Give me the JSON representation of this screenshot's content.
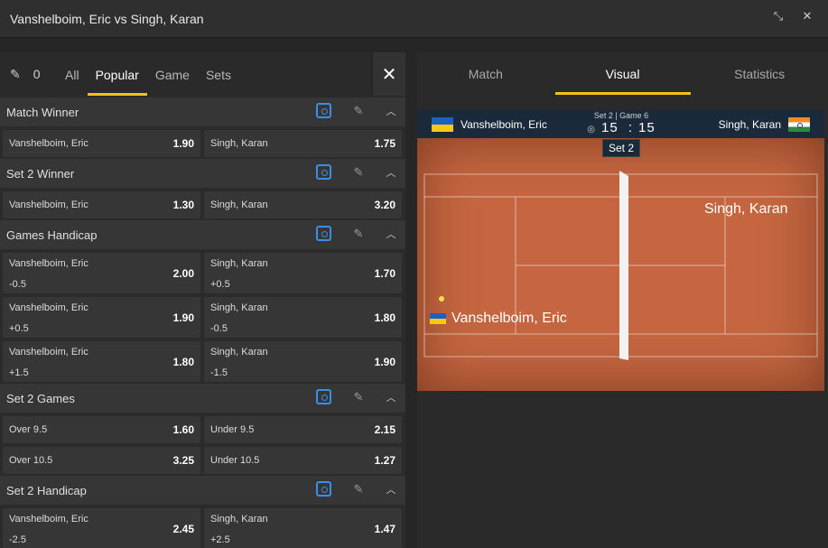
{
  "window": {
    "title": "Vanshelboim, Eric vs Singh, Karan"
  },
  "left_tabs": {
    "pin_count": "0",
    "tabs": [
      "All",
      "Popular",
      "Game",
      "Sets"
    ],
    "active": "Popular"
  },
  "markets": [
    {
      "name": "Match Winner",
      "rows": [
        [
          {
            "name": "Vanshelboim, Eric",
            "price": "1.90"
          },
          {
            "name": "Singh, Karan",
            "price": "1.75"
          }
        ]
      ]
    },
    {
      "name": "Set 2 Winner",
      "rows": [
        [
          {
            "name": "Vanshelboim, Eric",
            "price": "1.30"
          },
          {
            "name": "Singh, Karan",
            "price": "3.20"
          }
        ]
      ]
    },
    {
      "name": "Games Handicap",
      "rows": [
        [
          {
            "name": "Vanshelboim, Eric",
            "line": "-0.5",
            "price": "2.00"
          },
          {
            "name": "Singh, Karan",
            "line": "+0.5",
            "price": "1.70"
          }
        ],
        [
          {
            "name": "Vanshelboim, Eric",
            "line": "+0.5",
            "price": "1.90"
          },
          {
            "name": "Singh, Karan",
            "line": "-0.5",
            "price": "1.80"
          }
        ],
        [
          {
            "name": "Vanshelboim, Eric",
            "line": "+1.5",
            "price": "1.80"
          },
          {
            "name": "Singh, Karan",
            "line": "-1.5",
            "price": "1.90"
          }
        ]
      ]
    },
    {
      "name": "Set 2 Games",
      "rows": [
        [
          {
            "name": "Over 9.5",
            "price": "1.60"
          },
          {
            "name": "Under 9.5",
            "price": "2.15"
          }
        ],
        [
          {
            "name": "Over 10.5",
            "price": "3.25"
          },
          {
            "name": "Under 10.5",
            "price": "1.27"
          }
        ]
      ]
    },
    {
      "name": "Set 2 Handicap",
      "rows": [
        [
          {
            "name": "Vanshelboim, Eric",
            "line": "-2.5",
            "price": "2.45"
          },
          {
            "name": "Singh, Karan",
            "line": "+2.5",
            "price": "1.47"
          }
        ]
      ]
    }
  ],
  "right_tabs": {
    "tabs": [
      "Match",
      "Visual",
      "Statistics"
    ],
    "active": "Visual"
  },
  "scoreboard": {
    "player1": "Vanshelboim, Eric",
    "player2": "Singh, Karan",
    "set_game": "Set 2 | Game 6",
    "score1": "15",
    "score_sep": ":",
    "score2": "15",
    "set_badge": "Set 2"
  },
  "court": {
    "label_top": "Singh, Karan",
    "label_bottom": "Vanshelboim, Eric"
  },
  "colors": {
    "accent": "#f4c020",
    "stat_icon": "#3a8ee6",
    "court": "#c56640"
  }
}
